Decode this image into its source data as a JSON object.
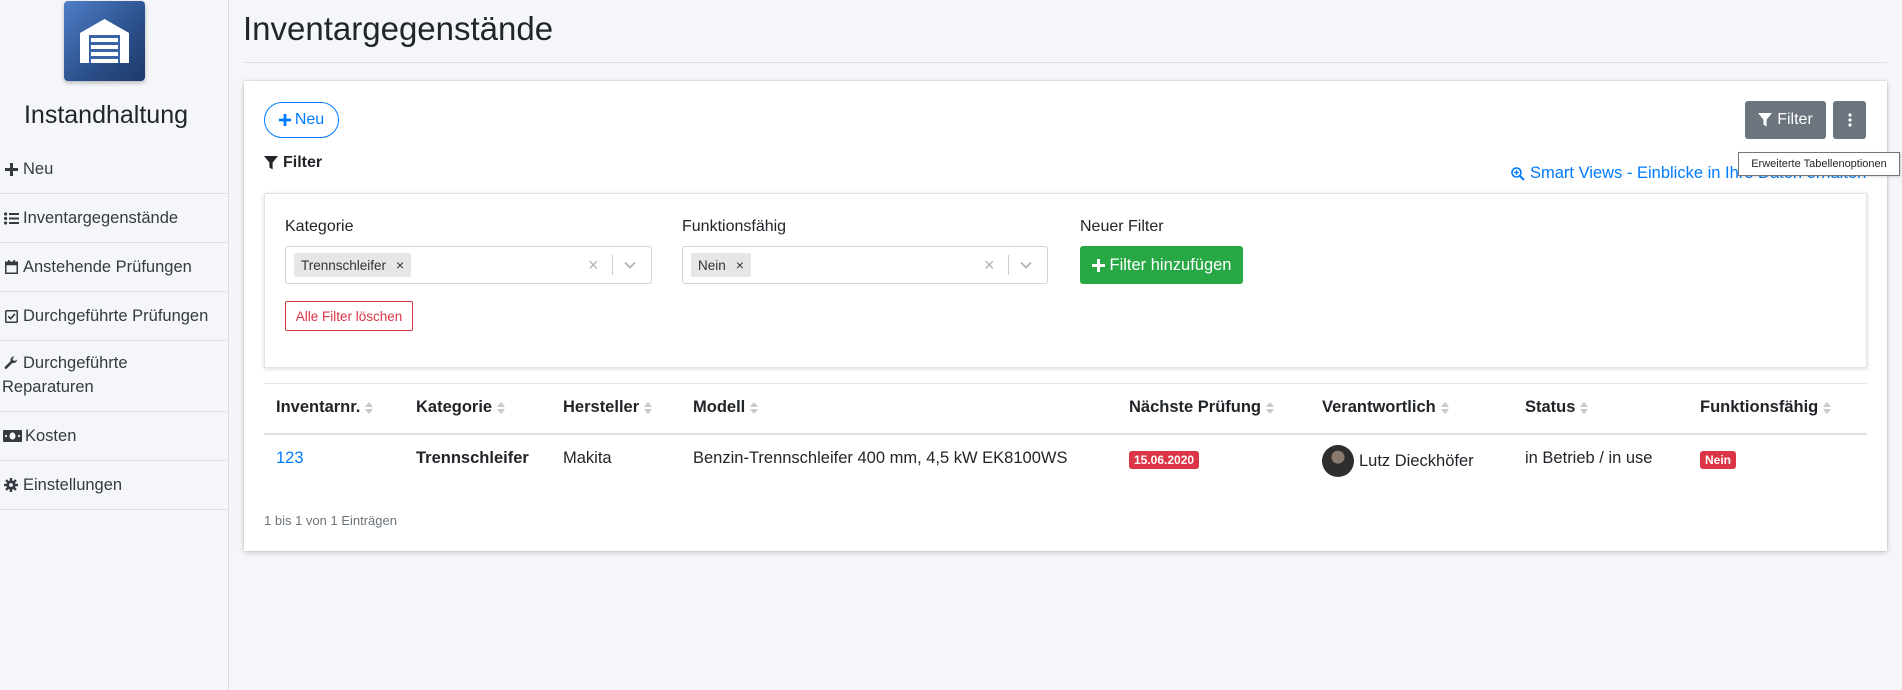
{
  "app": {
    "name": "Instandhaltung"
  },
  "sidebar": {
    "items": [
      {
        "label": "Neu",
        "icon": "plus-icon"
      },
      {
        "label": "Inventargegenstände",
        "icon": "list-icon"
      },
      {
        "label": "Anstehende Prüfungen",
        "icon": "calendar-icon"
      },
      {
        "label": "Durchgeführte Prüfungen",
        "icon": "calendar-check-icon"
      },
      {
        "label_line1": "Durchgeführte",
        "label_line2": "Reparaturen",
        "icon": "wrench-icon"
      },
      {
        "label": "Kosten",
        "icon": "money-icon"
      },
      {
        "label": "Einstellungen",
        "icon": "gear-icon"
      }
    ]
  },
  "page": {
    "title": "Inventargegenstände"
  },
  "toolbar": {
    "new_label": "Neu",
    "filter_toggle_label": "Filter",
    "more_tooltip": "Erweiterte Tabellenoptionen"
  },
  "filters": {
    "heading": "Filter",
    "smart_views_link": "Smart Views - Einblicke in Ihre Daten erhalten",
    "kategorie": {
      "label": "Kategorie",
      "selected": "Trennschleifer"
    },
    "funktionsfaehig": {
      "label": "Funktionsfähig",
      "selected": "Nein"
    },
    "new_filter": {
      "label": "Neuer Filter",
      "button": "Filter hinzufügen"
    },
    "clear_all": "Alle Filter löschen"
  },
  "table": {
    "columns": [
      "Inventarnr.",
      "Kategorie",
      "Hersteller",
      "Modell",
      "Nächste Prüfung",
      "Verantwortlich",
      "Status",
      "Funktionsfähig"
    ],
    "rows": [
      {
        "inventarnr": "123",
        "kategorie": "Trennschleifer",
        "hersteller": "Makita",
        "modell": "Benzin-Trennschleifer 400 mm, 4,5 kW EK8100WS",
        "naechste_pruefung": "15.06.2020",
        "verantwortlich": "Lutz Dieckhöfer",
        "status": "in Betrieb / in use",
        "funktionsfaehig": "Nein"
      }
    ],
    "info": "1 bis 1 von 1 Einträgen"
  },
  "colors": {
    "primary": "#007bff",
    "success": "#28a745",
    "danger": "#dc3545",
    "secondary": "#6c757d"
  }
}
